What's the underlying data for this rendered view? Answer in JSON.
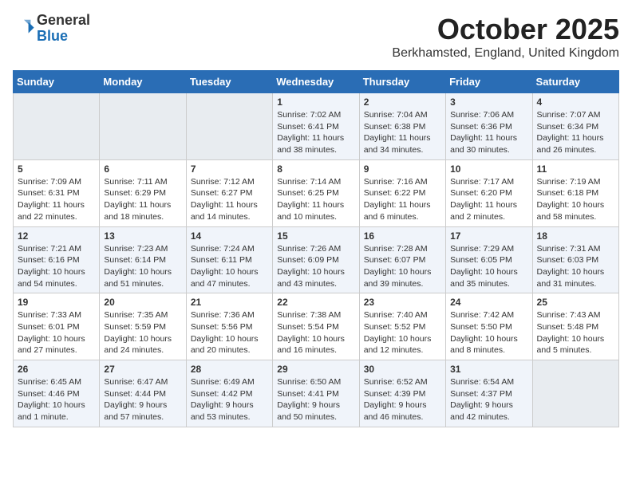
{
  "header": {
    "logo_general": "General",
    "logo_blue": "Blue",
    "month_title": "October 2025",
    "location": "Berkhamsted, England, United Kingdom"
  },
  "days_of_week": [
    "Sunday",
    "Monday",
    "Tuesday",
    "Wednesday",
    "Thursday",
    "Friday",
    "Saturday"
  ],
  "weeks": [
    [
      {
        "day": "",
        "content": ""
      },
      {
        "day": "",
        "content": ""
      },
      {
        "day": "",
        "content": ""
      },
      {
        "day": "1",
        "content": "Sunrise: 7:02 AM\nSunset: 6:41 PM\nDaylight: 11 hours and 38 minutes."
      },
      {
        "day": "2",
        "content": "Sunrise: 7:04 AM\nSunset: 6:38 PM\nDaylight: 11 hours and 34 minutes."
      },
      {
        "day": "3",
        "content": "Sunrise: 7:06 AM\nSunset: 6:36 PM\nDaylight: 11 hours and 30 minutes."
      },
      {
        "day": "4",
        "content": "Sunrise: 7:07 AM\nSunset: 6:34 PM\nDaylight: 11 hours and 26 minutes."
      }
    ],
    [
      {
        "day": "5",
        "content": "Sunrise: 7:09 AM\nSunset: 6:31 PM\nDaylight: 11 hours and 22 minutes."
      },
      {
        "day": "6",
        "content": "Sunrise: 7:11 AM\nSunset: 6:29 PM\nDaylight: 11 hours and 18 minutes."
      },
      {
        "day": "7",
        "content": "Sunrise: 7:12 AM\nSunset: 6:27 PM\nDaylight: 11 hours and 14 minutes."
      },
      {
        "day": "8",
        "content": "Sunrise: 7:14 AM\nSunset: 6:25 PM\nDaylight: 11 hours and 10 minutes."
      },
      {
        "day": "9",
        "content": "Sunrise: 7:16 AM\nSunset: 6:22 PM\nDaylight: 11 hours and 6 minutes."
      },
      {
        "day": "10",
        "content": "Sunrise: 7:17 AM\nSunset: 6:20 PM\nDaylight: 11 hours and 2 minutes."
      },
      {
        "day": "11",
        "content": "Sunrise: 7:19 AM\nSunset: 6:18 PM\nDaylight: 10 hours and 58 minutes."
      }
    ],
    [
      {
        "day": "12",
        "content": "Sunrise: 7:21 AM\nSunset: 6:16 PM\nDaylight: 10 hours and 54 minutes."
      },
      {
        "day": "13",
        "content": "Sunrise: 7:23 AM\nSunset: 6:14 PM\nDaylight: 10 hours and 51 minutes."
      },
      {
        "day": "14",
        "content": "Sunrise: 7:24 AM\nSunset: 6:11 PM\nDaylight: 10 hours and 47 minutes."
      },
      {
        "day": "15",
        "content": "Sunrise: 7:26 AM\nSunset: 6:09 PM\nDaylight: 10 hours and 43 minutes."
      },
      {
        "day": "16",
        "content": "Sunrise: 7:28 AM\nSunset: 6:07 PM\nDaylight: 10 hours and 39 minutes."
      },
      {
        "day": "17",
        "content": "Sunrise: 7:29 AM\nSunset: 6:05 PM\nDaylight: 10 hours and 35 minutes."
      },
      {
        "day": "18",
        "content": "Sunrise: 7:31 AM\nSunset: 6:03 PM\nDaylight: 10 hours and 31 minutes."
      }
    ],
    [
      {
        "day": "19",
        "content": "Sunrise: 7:33 AM\nSunset: 6:01 PM\nDaylight: 10 hours and 27 minutes."
      },
      {
        "day": "20",
        "content": "Sunrise: 7:35 AM\nSunset: 5:59 PM\nDaylight: 10 hours and 24 minutes."
      },
      {
        "day": "21",
        "content": "Sunrise: 7:36 AM\nSunset: 5:56 PM\nDaylight: 10 hours and 20 minutes."
      },
      {
        "day": "22",
        "content": "Sunrise: 7:38 AM\nSunset: 5:54 PM\nDaylight: 10 hours and 16 minutes."
      },
      {
        "day": "23",
        "content": "Sunrise: 7:40 AM\nSunset: 5:52 PM\nDaylight: 10 hours and 12 minutes."
      },
      {
        "day": "24",
        "content": "Sunrise: 7:42 AM\nSunset: 5:50 PM\nDaylight: 10 hours and 8 minutes."
      },
      {
        "day": "25",
        "content": "Sunrise: 7:43 AM\nSunset: 5:48 PM\nDaylight: 10 hours and 5 minutes."
      }
    ],
    [
      {
        "day": "26",
        "content": "Sunrise: 6:45 AM\nSunset: 4:46 PM\nDaylight: 10 hours and 1 minute."
      },
      {
        "day": "27",
        "content": "Sunrise: 6:47 AM\nSunset: 4:44 PM\nDaylight: 9 hours and 57 minutes."
      },
      {
        "day": "28",
        "content": "Sunrise: 6:49 AM\nSunset: 4:42 PM\nDaylight: 9 hours and 53 minutes."
      },
      {
        "day": "29",
        "content": "Sunrise: 6:50 AM\nSunset: 4:41 PM\nDaylight: 9 hours and 50 minutes."
      },
      {
        "day": "30",
        "content": "Sunrise: 6:52 AM\nSunset: 4:39 PM\nDaylight: 9 hours and 46 minutes."
      },
      {
        "day": "31",
        "content": "Sunrise: 6:54 AM\nSunset: 4:37 PM\nDaylight: 9 hours and 42 minutes."
      },
      {
        "day": "",
        "content": ""
      }
    ]
  ]
}
